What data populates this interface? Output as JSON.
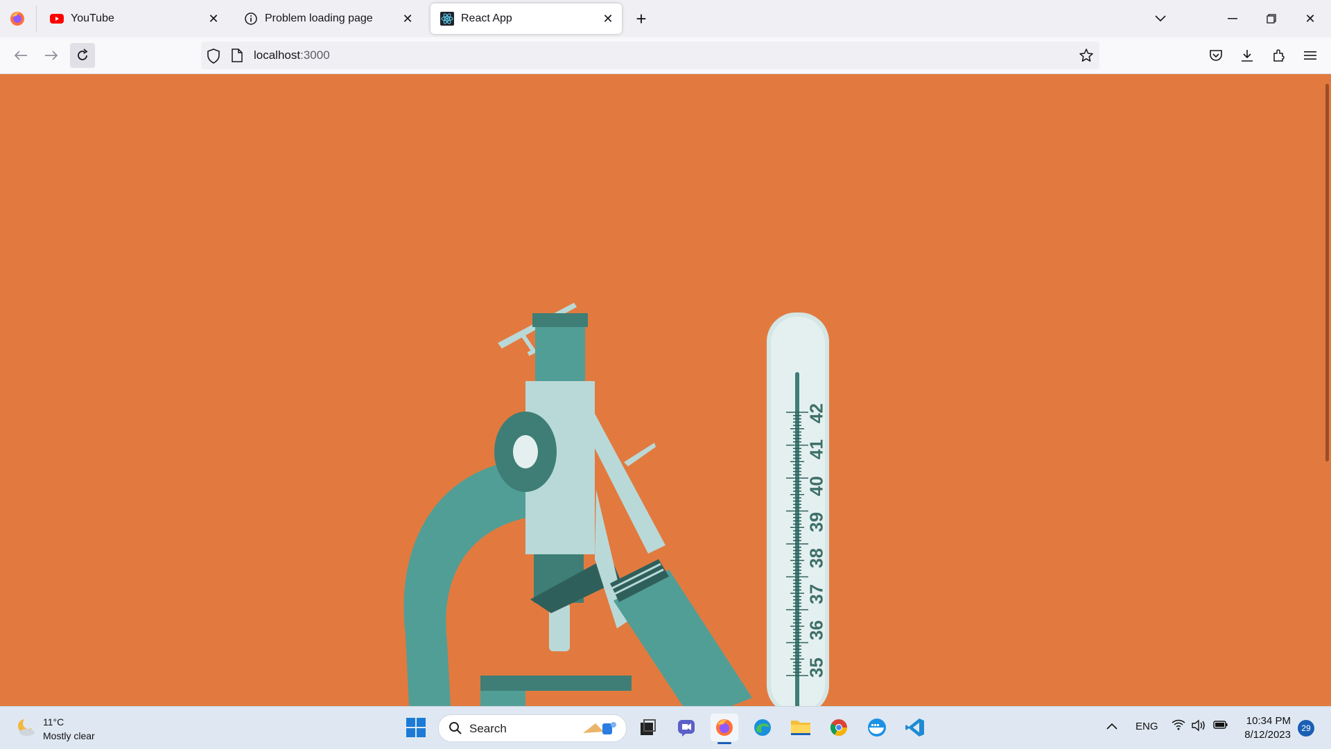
{
  "browser": {
    "tabs": [
      {
        "label": "YouTube",
        "icon": "youtube-icon",
        "active": false
      },
      {
        "label": "Problem loading page",
        "icon": "info-icon",
        "active": false
      },
      {
        "label": "React App",
        "icon": "react-icon",
        "active": true
      }
    ],
    "url_host": "localhost",
    "url_port": ":3000"
  },
  "page": {
    "background_color": "#e27a3f",
    "illustration": "microscope-and-thermometer",
    "thermometer_scale": [
      "42",
      "41",
      "40",
      "39",
      "38",
      "37",
      "36",
      "35"
    ]
  },
  "taskbar": {
    "weather_temp": "11°C",
    "weather_desc": "Mostly clear",
    "search_placeholder": "Search",
    "language": "ENG",
    "time": "10:34 PM",
    "date": "8/12/2023",
    "notification_count": "29"
  }
}
